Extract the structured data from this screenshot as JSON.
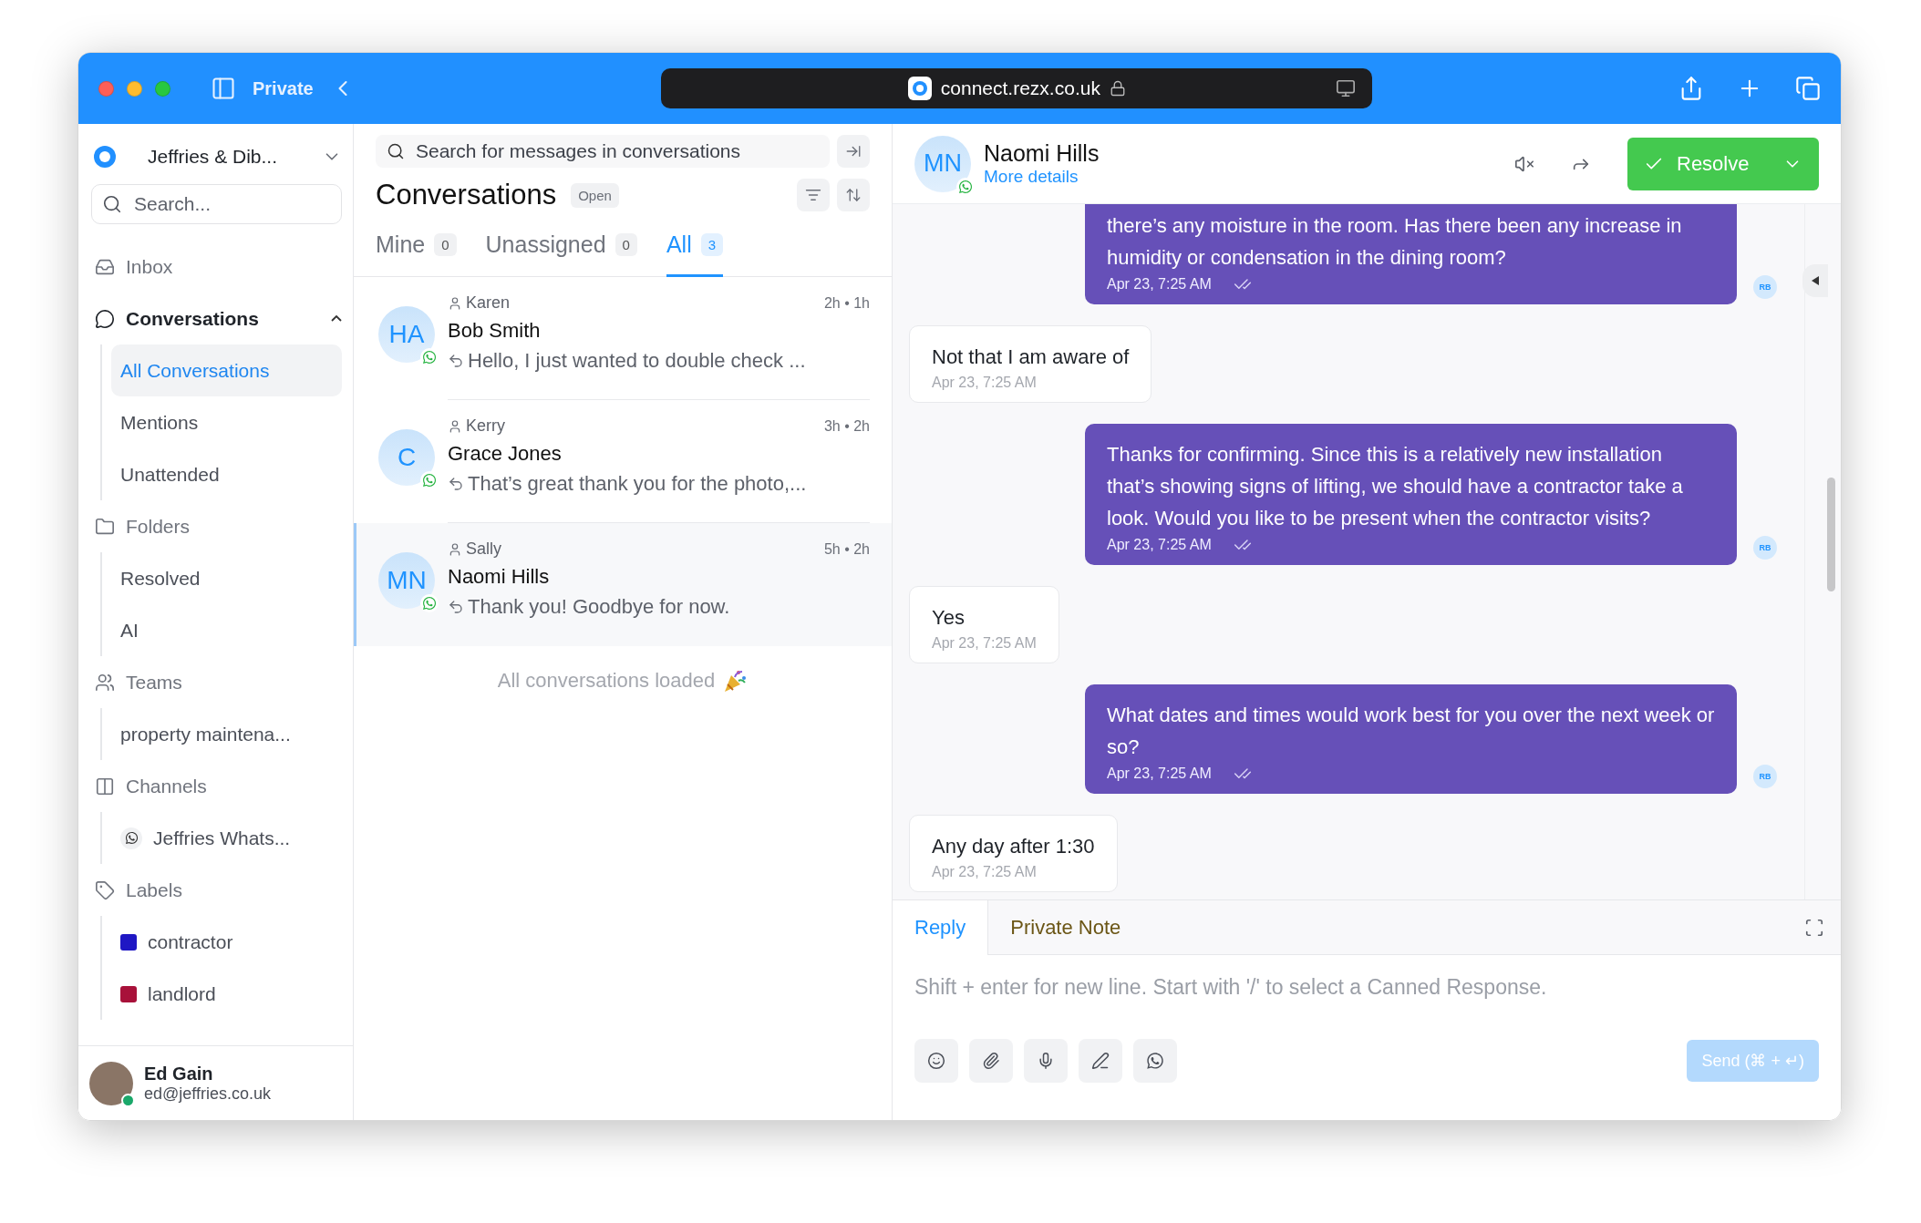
{
  "browser": {
    "mode": "Private",
    "url": "connect.rezx.co.uk"
  },
  "sidebar": {
    "account": "Jeffries & Dib...",
    "search_placeholder": "Search...",
    "sections": [
      {
        "label": "Inbox"
      },
      {
        "label": "Conversations",
        "expanded": true,
        "children": [
          {
            "kind": "link",
            "label": "All Conversations",
            "selected": true
          },
          {
            "kind": "link",
            "label": "Mentions",
            "selected": false
          },
          {
            "kind": "link",
            "label": "Unattended",
            "selected": false
          }
        ]
      },
      {
        "label": "Folders",
        "children": [
          {
            "kind": "link",
            "label": "Resolved",
            "selected": false
          },
          {
            "kind": "link",
            "label": "AI",
            "selected": false
          }
        ]
      },
      {
        "label": "Teams",
        "children": [
          {
            "kind": "link",
            "label": "property maintena...",
            "selected": false
          }
        ]
      },
      {
        "label": "Channels",
        "children": [
          {
            "kind": "channel",
            "label": "Jeffries Whats...",
            "selected": false
          }
        ]
      },
      {
        "label": "Labels",
        "children": [
          {
            "kind": "label",
            "label": "contractor",
            "color": "#1f17c4",
            "selected": false
          },
          {
            "kind": "label",
            "label": "landlord",
            "color": "#a8113a",
            "selected": false
          }
        ]
      }
    ],
    "user": {
      "name": "Ed Gain",
      "email": "ed@jeffries.co.uk",
      "online": true
    }
  },
  "list": {
    "search_placeholder": "Search for messages in conversations",
    "title": "Conversations",
    "status": "Open",
    "tabs": [
      {
        "label": "Mine",
        "count": "0",
        "selected": false
      },
      {
        "label": "Unassigned",
        "count": "0",
        "selected": false
      },
      {
        "label": "All",
        "count": "3",
        "selected": true
      }
    ],
    "conversations": [
      {
        "initials": "HA",
        "assignee": "Karen",
        "name": "Bob Smith",
        "time": "2h • 1h",
        "preview": "Hello, I just wanted to double check ...",
        "selected": false
      },
      {
        "initials": "C",
        "assignee": "Kerry",
        "name": "Grace Jones",
        "time": "3h • 2h",
        "preview": "That’s great thank you for the photo,...",
        "selected": false
      },
      {
        "initials": "MN",
        "assignee": "Sally",
        "name": "Naomi Hills",
        "time": "5h • 2h",
        "preview": "Thank you! Goodbye for now.",
        "selected": true
      }
    ],
    "footer": "All conversations loaded"
  },
  "chat": {
    "contact": {
      "initials": "MN",
      "name": "Naomi Hills",
      "link": "More details"
    },
    "resolve": "Resolve",
    "messages": [
      {
        "kind": "outgoing",
        "text": "there’s any moisture in the room. Has there been any increase in humidity or condensation in the dining room?",
        "time": "Apr 23, 7:25 AM",
        "sender": "RB"
      },
      {
        "kind": "incoming",
        "text": "Not that I am aware of",
        "time": "Apr 23, 7:25 AM"
      },
      {
        "kind": "outgoing",
        "text": "Thanks for confirming. Since this is a relatively new installation that’s showing signs of lifting, we should have a contractor take a look. Would you like to be present when the contractor visits?",
        "time": "Apr 23, 7:25 AM",
        "sender": "RB"
      },
      {
        "kind": "incoming",
        "text": "Yes",
        "time": "Apr 23, 7:25 AM"
      },
      {
        "kind": "outgoing",
        "text": "What dates and times would work best for you over the next week or so?",
        "time": "Apr 23, 7:25 AM",
        "sender": "RB"
      },
      {
        "kind": "incoming",
        "text": "Any day after 1:30",
        "time": "Apr 23, 7:25 AM"
      }
    ],
    "composer": {
      "tabs": [
        {
          "label": "Reply",
          "selected": true
        },
        {
          "label": "Private Note",
          "selected": false
        }
      ],
      "placeholder": "Shift + enter for new line. Start with '/' to select a Canned Response.",
      "send": {
        "label": "Send (⌘ + ↵)",
        "disabled": true
      }
    }
  }
}
